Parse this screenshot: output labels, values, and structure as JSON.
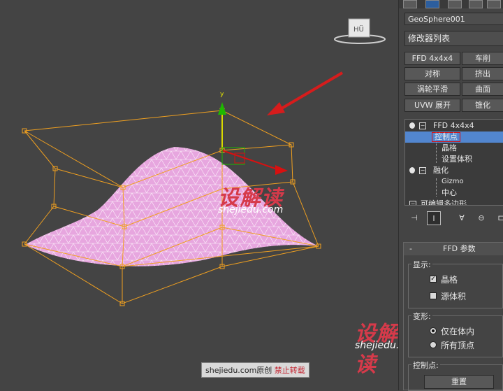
{
  "viewport": {
    "axis_label": "y",
    "viewcube_label": "HÜ"
  },
  "watermarks": {
    "logo_text": "设解读",
    "url_text": "shejiedu.com",
    "footer_site": "shejiedu.com原创",
    "footer_warning": "禁止转载"
  },
  "panel": {
    "object_name": "GeoSphere001",
    "modifier_list": "修改器列表",
    "buttons": [
      {
        "label": "FFD 4x4x4"
      },
      {
        "label": "车削"
      },
      {
        "label": "对称"
      },
      {
        "label": "挤出"
      },
      {
        "label": "涡轮平滑"
      },
      {
        "label": "曲面"
      },
      {
        "label": "UVW 展开"
      },
      {
        "label": "锥化"
      }
    ],
    "stack": [
      {
        "label": "FFD 4x4x4"
      },
      {
        "label": "控制点"
      },
      {
        "label": "晶格"
      },
      {
        "label": "设置体积"
      },
      {
        "label": "融化"
      },
      {
        "label": "Gizmo"
      },
      {
        "label": "中心"
      },
      {
        "label": "可编辑多边形"
      }
    ],
    "rollout": {
      "collapse": "-",
      "title": "FFD 参数",
      "display_group": "显示:",
      "lattice_label": "晶格",
      "lattice_checked": true,
      "source_volume_label": "源体积",
      "source_volume_checked": false,
      "deform_group": "变形:",
      "only_in_volume": "仅在体内",
      "all_vertices": "所有顶点",
      "control_points_group": "控制点:",
      "reset_button": "重置"
    }
  },
  "colors": {
    "lattice": "#f0a020",
    "mesh": "#e7a6df",
    "selection": "#5286cf",
    "watermark_red": "#d63a4a"
  }
}
